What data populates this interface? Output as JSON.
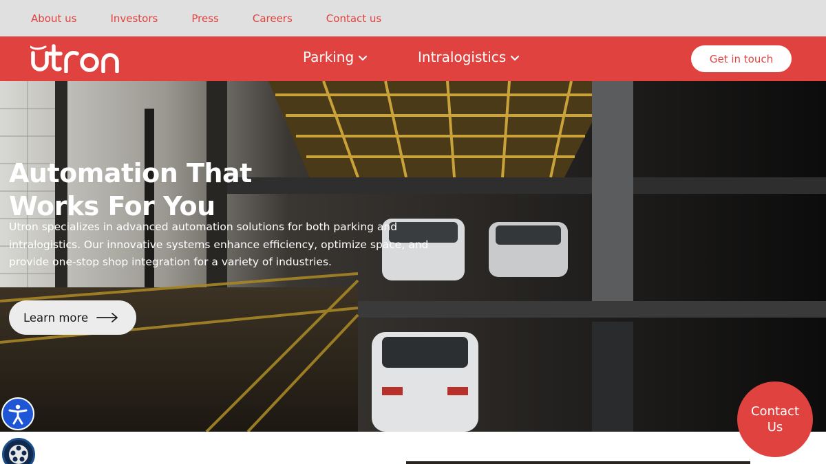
{
  "util_bar": {
    "links": [
      "About us",
      "Investors",
      "Press",
      "Careers",
      "Contact us"
    ]
  },
  "nav": {
    "logo_text": "utron",
    "items": [
      {
        "label": "Parking",
        "icon": "chevron-down-icon"
      },
      {
        "label": "Intralogistics",
        "icon": "chevron-down-icon"
      }
    ],
    "cta_label": "Get in touch"
  },
  "hero": {
    "title_line1": "Automation That",
    "title_line2": "Works For You",
    "description": "Utron specializes in advanced automation solutions for both parking and intralogistics. Our innovative systems enhance efficiency, optimize space, and provide one-stop shop integration for a variety of industries.",
    "cta_label": "Learn more",
    "cta_icon": "arrow-right-icon"
  },
  "widgets": {
    "accessibility_icon": "accessibility-icon",
    "video_icon": "film-reel-icon",
    "contact_line1": "Contact",
    "contact_line2": "Us"
  },
  "colors": {
    "brand": "#e0433f",
    "util_bg": "#e0e0e0",
    "a11y_blue": "#1f56d6"
  }
}
